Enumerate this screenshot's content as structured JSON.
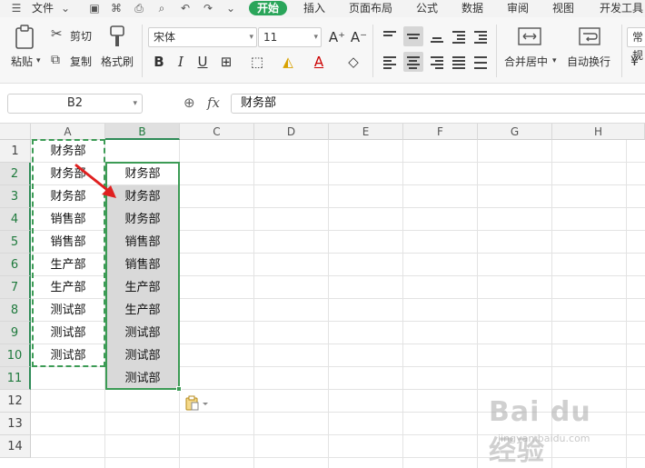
{
  "menubar": {
    "file_label": "文件",
    "tabs": [
      "开始",
      "插入",
      "页面布局",
      "公式",
      "数据",
      "审阅",
      "视图",
      "开发工具"
    ],
    "active_tab": "开始"
  },
  "ribbon": {
    "paste_label": "粘贴",
    "cut_label": "剪切",
    "copy_label": "复制",
    "format_painter_label": "格式刷",
    "font_name": "宋体",
    "font_size": "11",
    "merge_center_label": "合并居中",
    "wrap_text_label": "自动换行",
    "number_format": "常规",
    "grow_font_label": "A⁺",
    "shrink_font_label": "A⁻",
    "bold_label": "B",
    "italic_label": "I",
    "underline_label": "U",
    "font_color_label": "A"
  },
  "formula_bar": {
    "name_box": "B2",
    "fx_label": "fx",
    "value": "财务部"
  },
  "sheet": {
    "columns": [
      "A",
      "B",
      "C",
      "D",
      "E",
      "F",
      "G",
      "H"
    ],
    "selected_column": "B",
    "rows": [
      "1",
      "2",
      "3",
      "4",
      "5",
      "6",
      "7",
      "8",
      "9",
      "10",
      "11",
      "12",
      "13",
      "14"
    ],
    "column_a": [
      "财务部",
      "财务部",
      "财务部",
      "销售部",
      "销售部",
      "生产部",
      "生产部",
      "测试部",
      "测试部",
      "测试部"
    ],
    "column_b": [
      "财务部",
      "财务部",
      "财务部",
      "销售部",
      "销售部",
      "生产部",
      "生产部",
      "测试部",
      "测试部",
      "测试部"
    ]
  },
  "watermark": {
    "logo_text": "Bai du 经验",
    "url": "jingyan.baidu.com"
  },
  "colors": {
    "accent": "#2aa55a",
    "selection_border": "#3c9b55",
    "arrow": "#e02020"
  }
}
